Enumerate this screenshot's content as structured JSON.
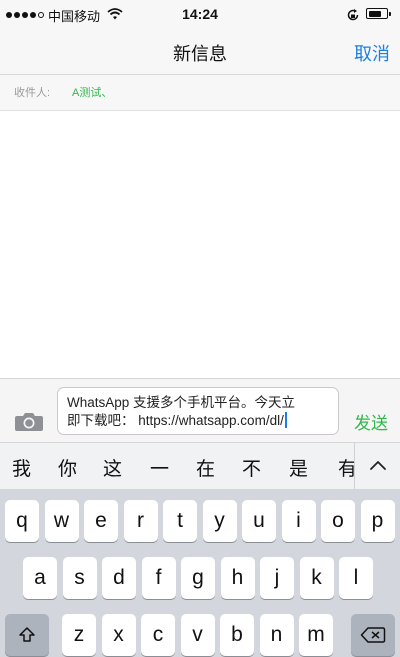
{
  "status_bar": {
    "carrier": "中国移动",
    "time": "14:24",
    "signal_bars": 4,
    "signal_total": 5
  },
  "nav": {
    "title": "新信息",
    "cancel_label": "取消"
  },
  "recipients": {
    "label": "收件人:",
    "value": "A测试、"
  },
  "compose": {
    "message_line1": "WhatsApp 支援多个手机平台。今天立",
    "message_line2": "即下载吧： https://whatsapp.com/dl/",
    "send_label": "发送"
  },
  "candidates": [
    "我",
    "你",
    "这",
    "一",
    "在",
    "不",
    "是",
    "有"
  ],
  "keyboard": {
    "row1": [
      "q",
      "w",
      "e",
      "r",
      "t",
      "y",
      "u",
      "i",
      "o",
      "p"
    ],
    "row2": [
      "a",
      "s",
      "d",
      "f",
      "g",
      "h",
      "j",
      "k",
      "l"
    ],
    "row3": [
      "z",
      "x",
      "c",
      "v",
      "b",
      "n",
      "m"
    ]
  },
  "icons": {
    "wifi": "wifi-icon",
    "lock": "rotation-lock-icon",
    "battery": "battery-icon",
    "camera": "camera-icon",
    "expand": "chevron-up-icon",
    "shift": "shift-icon",
    "delete": "delete-icon"
  },
  "colors": {
    "accent_blue": "#1a7fe8",
    "accent_green": "#2fb84b"
  }
}
